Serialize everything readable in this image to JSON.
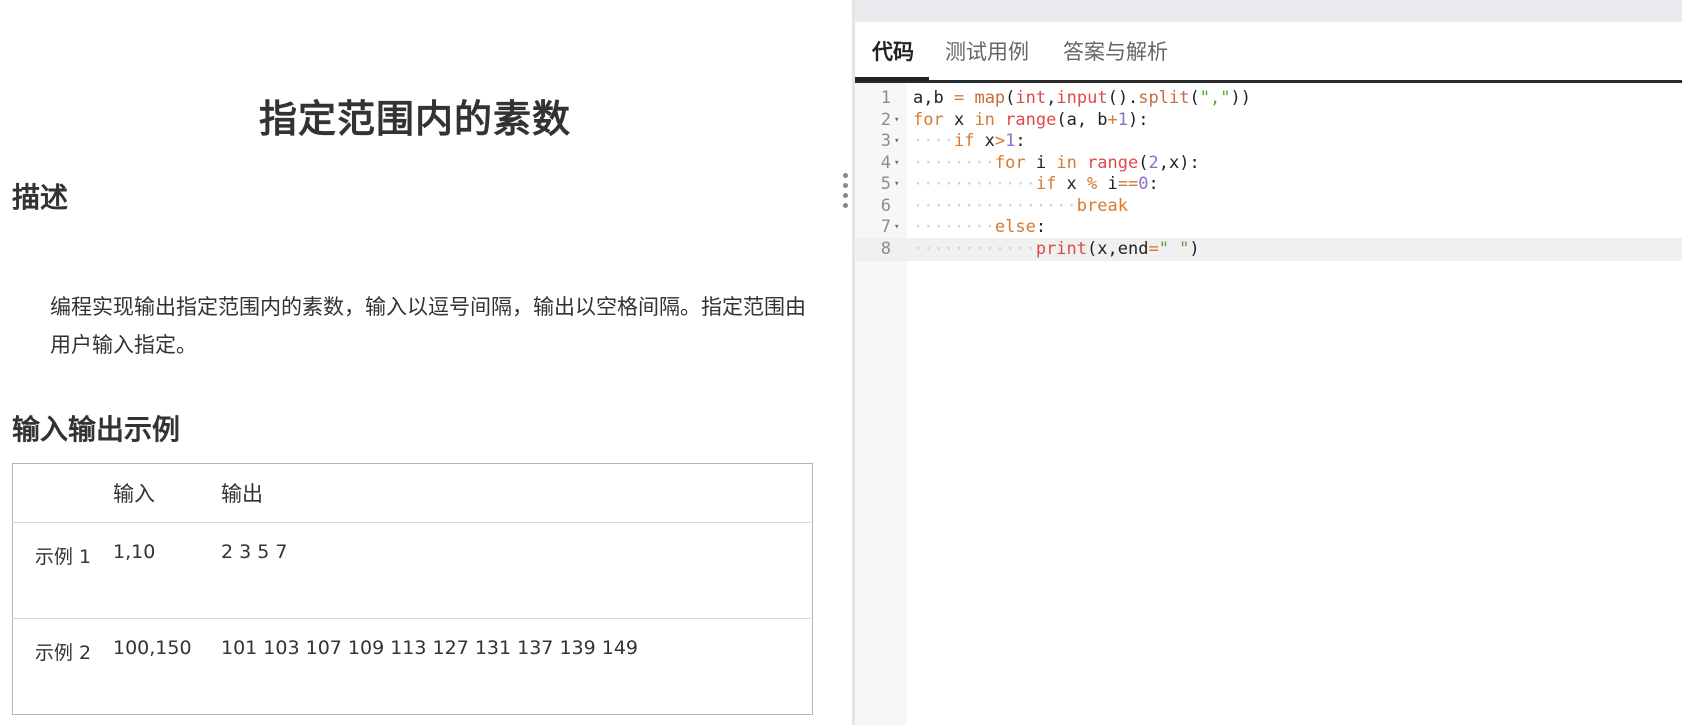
{
  "problem": {
    "title": "指定范围内的素数",
    "desc_heading": "描述",
    "description": "编程实现输出指定范围内的素数，输入以逗号间隔，输出以空格间隔。指定范围由用户输入指定。",
    "io_heading": "输入输出示例",
    "table": {
      "header_input": "输入",
      "header_output": "输出",
      "rows": [
        {
          "label": "示例 1",
          "input": "1,10",
          "output": "2 3 5 7"
        },
        {
          "label": "示例 2",
          "input": "100,150",
          "output": "101 103 107 109 113 127 131 137 139 149"
        }
      ]
    }
  },
  "editor": {
    "tabs": [
      {
        "label": "代码",
        "active": true
      },
      {
        "label": "测试用例",
        "active": false
      },
      {
        "label": "答案与解析",
        "active": false
      }
    ],
    "line_numbers": [
      "1",
      "2",
      "3",
      "4",
      "5",
      "6",
      "7",
      "8"
    ],
    "code_lines": [
      "a,b = map(int,input().split(\",\"))",
      "for x in range(a, b+1):",
      "    if x>1:",
      "        for i in range(2,x):",
      "            if x % i==0:",
      "                break",
      "        else:",
      "            print(x,end=\" \")"
    ],
    "current_line": "8",
    "colors": {
      "keyword": "#d9792d",
      "builtin": "#e0494a",
      "number": "#8a6fcb",
      "string": "#52a83a",
      "tab_underline": "#222222"
    }
  }
}
